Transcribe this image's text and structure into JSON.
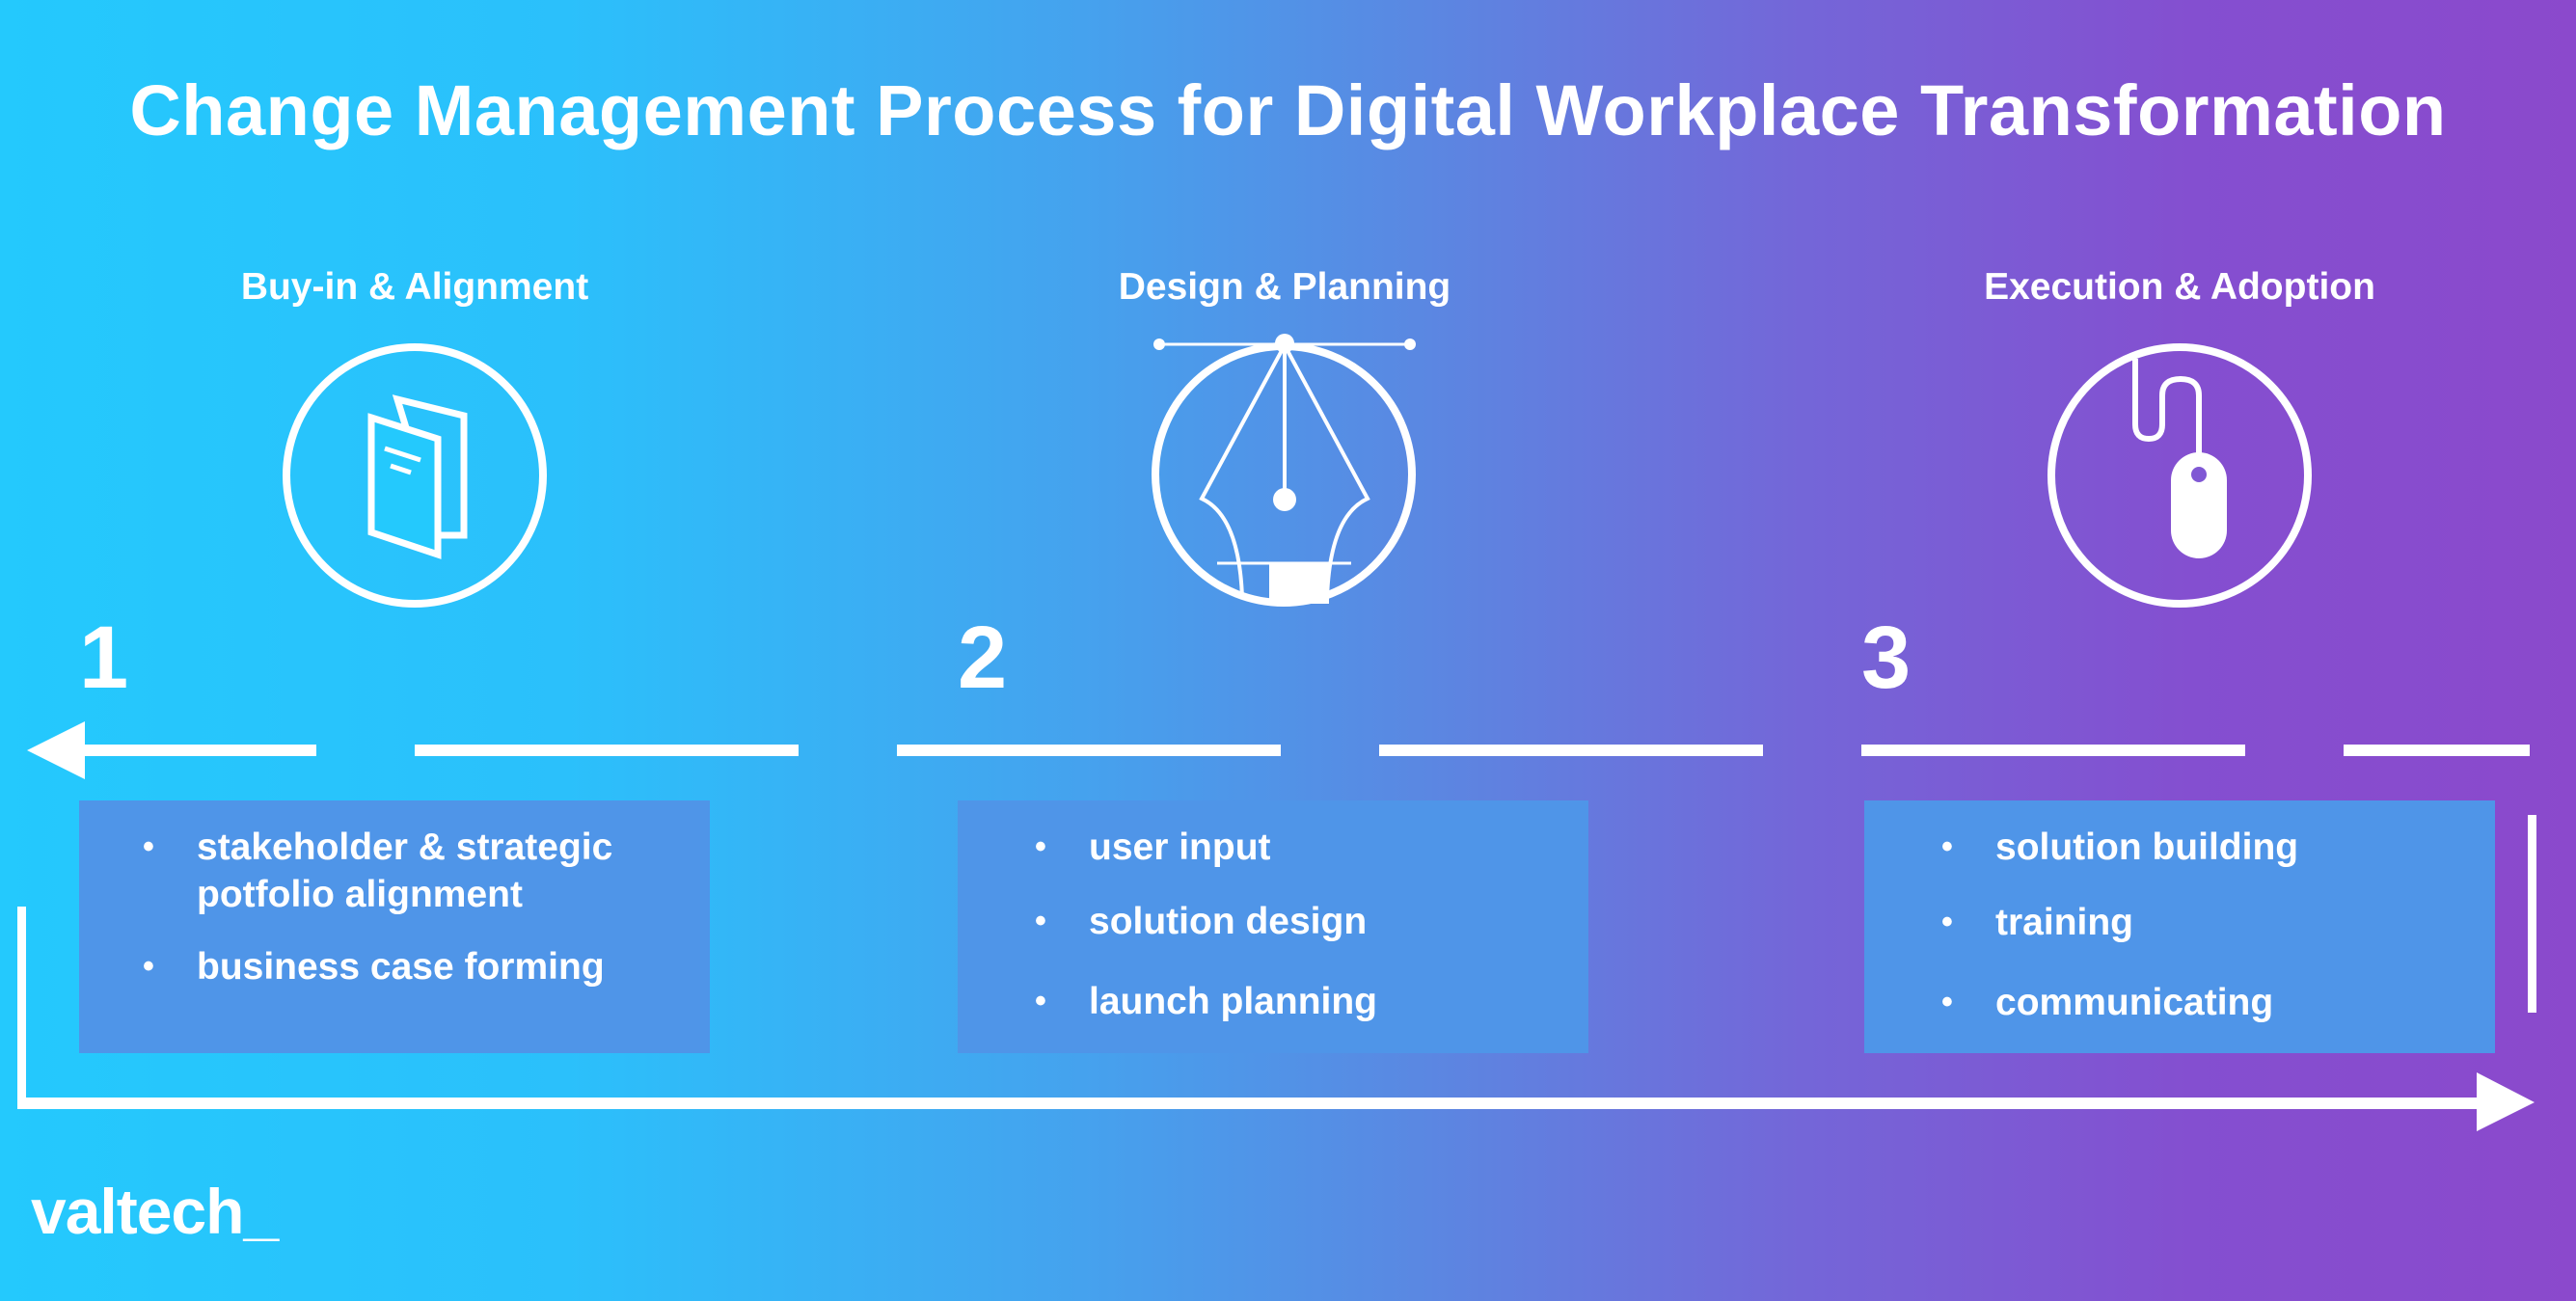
{
  "title": "Change Management Process for Digital Workplace Transformation",
  "colors": {
    "gradient_start": "#24c9fd",
    "gradient_end": "#8b49cc",
    "box_fill": "#4f95e8",
    "foreground": "#ffffff"
  },
  "stages": [
    {
      "number": "1",
      "label": "Buy-in & Alignment",
      "icon": "brochure-icon",
      "items": [
        "stakeholder & strategic",
        "potfolio alignment",
        "business case forming"
      ]
    },
    {
      "number": "2",
      "label": "Design & Planning",
      "icon": "pen-tool-icon",
      "items": [
        "user input",
        "solution design",
        "launch planning"
      ]
    },
    {
      "number": "3",
      "label": "Execution & Adoption",
      "icon": "mouse-icon",
      "items": [
        "solution building",
        "training",
        "communicating"
      ]
    }
  ],
  "bullet_glyph": "•",
  "logo": "valtech_"
}
